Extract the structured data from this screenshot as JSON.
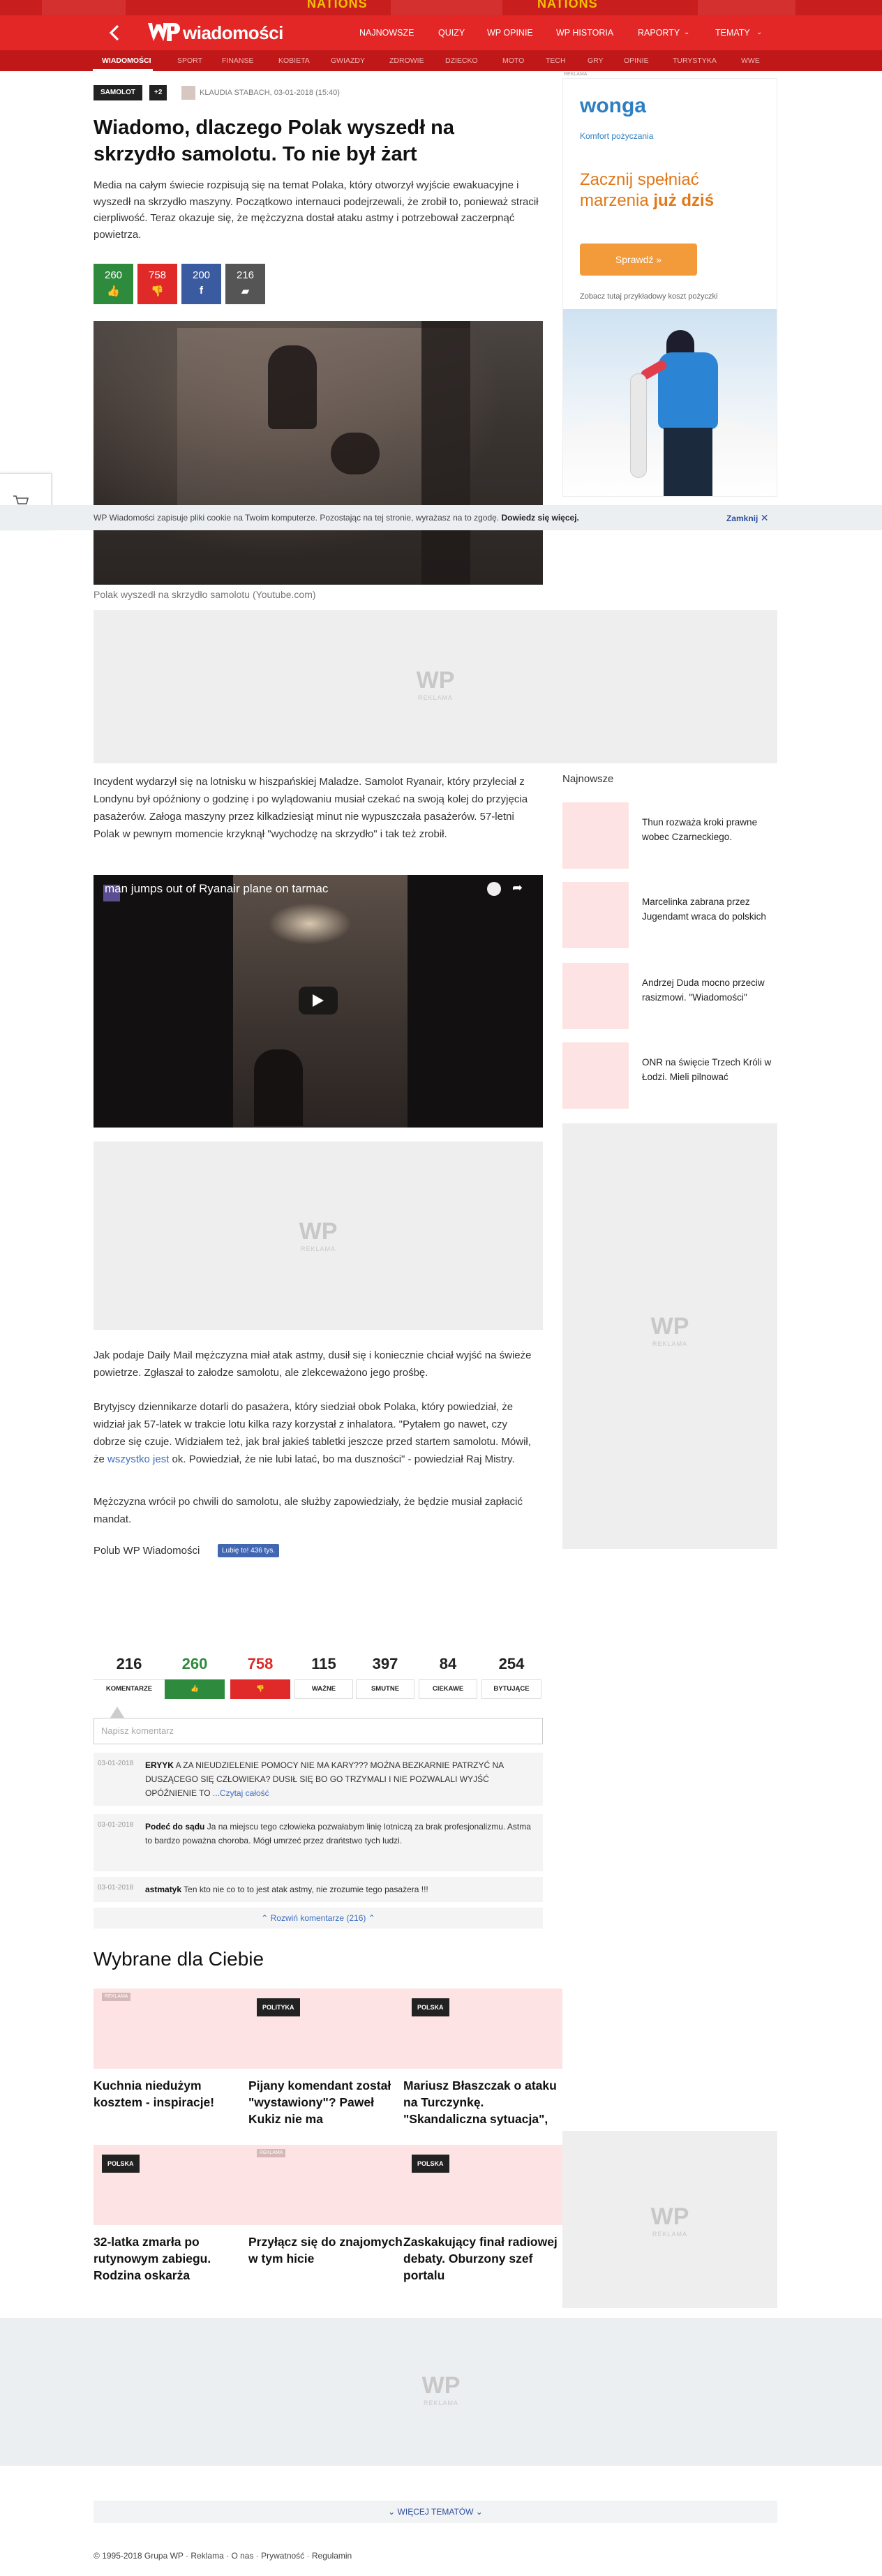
{
  "banner": {
    "text_left": "NATIONS",
    "text_right": "NATIONS"
  },
  "header": {
    "logo_text": "wiadomości",
    "nav": [
      "NAJNOWSZE",
      "QUIZY",
      "WP OPINIE",
      "WP HISTORIA",
      "RAPORTY",
      "TEMATY"
    ],
    "subnav": [
      "WIADOMOŚCI",
      "SPORT",
      "FINANSE",
      "KOBIETA",
      "GWIAZDY",
      "ZDROWIE",
      "DZIECKO",
      "MOTO",
      "TECH",
      "GRY",
      "OPINIE",
      "TURYSTYKA",
      "WWE"
    ]
  },
  "article": {
    "tag": "SAMOLOT",
    "tag_more": "+2",
    "author_date": "KLAUDIA STABACH, 03-01-2018 (15:40)",
    "title": "Wiadomo, dlaczego Polak wyszedł na skrzydło samolotu. To nie był żart",
    "lead": "Media na całym świecie rozpisują się na temat Polaka, który otworzył wyjście ewakuacyjne i wyszedł na skrzydło maszyny. Początkowo internauci podejrzewali, że zrobił to, ponieważ stracił cierpliwość. Teraz okazuje się, że mężczyzna dostał ataku astmy i potrzebował zaczerpnąć powietrza.",
    "votes": {
      "up": "260",
      "down": "758",
      "fb": "200",
      "comments": "216"
    },
    "image_caption": "Polak wyszedł na skrzydło samolotu (Youtube.com)",
    "p1": "Incydent wydarzył się na lotnisku w hiszpańskiej Maladze. Samolot Ryanair, który przyleciał z Londynu był opóźniony o godzinę i po wylądowaniu musiał czekać na swoją kolej do przyjęcia pasażerów. Załoga maszyny przez kilkadziesiąt minut nie wypuszczała pasażerów. 57-letni Polak w pewnym momencie krzyknął \"wychodzę na skrzydło\" i tak też zrobił.",
    "video_title": "man jumps out of Ryanair plane on tarmac",
    "p2": "Jak podaje Daily Mail mężczyzna miał atak astmy, dusił się i koniecznie chciał wyjść na świeże powietrze. Zgłaszał to załodze samolotu, ale zlekceważono jego prośbę.",
    "p3a": "Brytyjscy dziennikarze dotarli do pasażera, który siedział obok Polaka, który powiedział, że widział jak 57-latek w trakcie lotu kilka razy korzystał z inhalatora. \"Pytałem go nawet, czy dobrze się czuje. Widziałem też, jak brał jakieś tabletki jeszcze przed startem samolotu. Mówił, że ",
    "p3link": "wszystko jest",
    "p3b": " ok. Powiedział, że nie lubi latać, bo ma duszności\" - powiedział Raj Mistry.",
    "p4": "Mężczyzna wrócił po chwili do samolotu, ale służby zapowiedziały, że będzie musiał zapłacić mandat.",
    "like_label": "Polub WP Wiadomości",
    "fb_like": "Lubię to! 436 tys."
  },
  "ad": {
    "label": "REKLAMA",
    "wonga_logo": "wonga",
    "wonga_sub": "Komfort pożyczania",
    "wonga_head1": "Zacznij spełniać",
    "wonga_head2a": "marzenia ",
    "wonga_head2b": "już dziś",
    "wonga_btn": "Sprawdź »",
    "wonga_foot": "Zobacz tutaj przykładowy koszt pożyczki",
    "wp_text": "WP"
  },
  "cookie": {
    "text": "WP Wiadomości zapisuje pliki cookie na Twoim komputerze. Pozostając na tej stronie, wyrażasz na to zgodę.",
    "link": "Dowiedz się więcej.",
    "close": "Zamknij"
  },
  "sidebar": {
    "title": "Najnowsze",
    "items": [
      "Thun rozważa kroki prawne wobec Czarneckiego.",
      "Marcelinka zabrana przez Jugendamt wraca do polskich",
      "Andrzej Duda mocno przeciw rasizmowi. \"Wiadomości\"",
      "ONR na święcie Trzech Króli w Łodzi. Mieli pilnować"
    ]
  },
  "reactions": [
    {
      "n": "216",
      "label": "KOMENTARZE",
      "color": "#222"
    },
    {
      "n": "260",
      "label": "👍",
      "color": "#2e8b3e"
    },
    {
      "n": "758",
      "label": "👎",
      "color": "#e02a2a"
    },
    {
      "n": "115",
      "label": "WAŻNE",
      "color": "#222"
    },
    {
      "n": "397",
      "label": "SMUTNE",
      "color": "#222"
    },
    {
      "n": "84",
      "label": "CIEKAWE",
      "color": "#222"
    },
    {
      "n": "254",
      "label": "BYTUJĄCE",
      "color": "#222"
    }
  ],
  "comments": {
    "placeholder": "Napisz komentarz",
    "items": [
      {
        "date": "03-01-2018",
        "author": "ERYYK",
        "text": " A ZA NIEUDZIELENIE POMOCY NIE MA KARY??? MOŻNA BEZKARNIE PATRZYĆ NA DUSZĄCEGO SIĘ CZŁOWIEKA? DUSIŁ SIĘ BO GO TRZYMALI I NIE POZWALALI WYJŚĆ OPÓŹNIENIE TO ",
        "more": "...Czytaj całość"
      },
      {
        "date": "03-01-2018",
        "author": "Podeć do sądu",
        "text": " Ja na miejscu tego człowieka pozwałabym linię lotniczą za brak profesjonalizmu. Astma to bardzo poważna choroba. Mógł umrzeć przez drańtstwo tych ludzi.",
        "more": ""
      },
      {
        "date": "03-01-2018",
        "author": "astmatyk",
        "text": " Ten kto nie co to to jest atak astmy, nie zrozumie tego pasażera !!!",
        "more": ""
      }
    ],
    "expand": "⌃ Rozwiń komentarze (216) ⌃"
  },
  "recommended": {
    "title": "Wybrane dla Ciebie",
    "items": [
      {
        "label": "REKLAMA",
        "title": "Kuchnia niedużym kosztem - inspiracje!"
      },
      {
        "label": "POLITYKA",
        "title": "Pijany komendant został \"wystawiony\"? Paweł Kukiz nie ma"
      },
      {
        "label": "POLSKA",
        "title": "Mariusz Błaszczak o ataku na Turczynkę. \"Skandaliczna sytuacja\","
      },
      {
        "label": "POLSKA",
        "title": "32-latka zmarła po rutynowym zabiegu. Rodzina oskarża"
      },
      {
        "label": "REKLAMA",
        "title": "Przyłącz się do znajomych w tym hicie"
      },
      {
        "label": "POLSKA",
        "title": "Zaskakujący finał radiowej debaty. Oburzony szef portalu"
      }
    ]
  },
  "footer": {
    "more_topics": "⌄ WIĘCEJ TEMATÓW ⌄",
    "links": [
      "© 1995-2018 Grupa WP",
      "Reklama",
      "O nas",
      "Prywatność",
      "Regulamin"
    ]
  }
}
